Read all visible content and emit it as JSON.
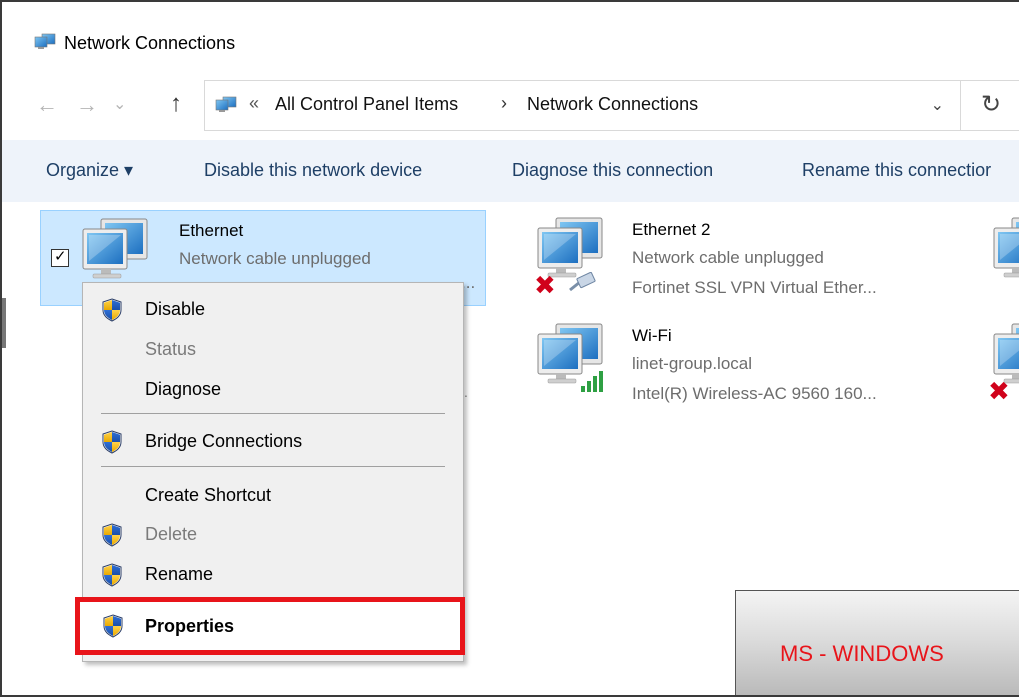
{
  "window": {
    "title": "Network Connections",
    "title_icon": "network-connections-icon"
  },
  "address": {
    "chevrons": "«",
    "crumb1": "All Control Panel Items",
    "separator": "›",
    "crumb2": "Network Connections"
  },
  "nav": {
    "back": "←",
    "forward": "→",
    "recent": "⌄",
    "up": "↑",
    "dropdown": "⌄",
    "refresh": "↻"
  },
  "commands": {
    "organize": "Organize ▾",
    "disable": "Disable this network device",
    "diagnose": "Diagnose this connection",
    "rename": "Rename this connectior"
  },
  "items": {
    "ethernet": {
      "name": "Ethernet",
      "status": "Network cable unplugged",
      "device_tail": "..."
    },
    "ethernet2": {
      "name": "Ethernet 2",
      "status": "Network cable unplugged",
      "device": "Fortinet SSL VPN Virtual Ether..."
    },
    "wifi": {
      "name": "Wi-Fi",
      "status": "linet-group.local",
      "device": "Intel(R) Wireless-AC 9560 160..."
    },
    "stray_dot": "."
  },
  "context_menu": {
    "disable": "Disable",
    "status": "Status",
    "diagnose": "Diagnose",
    "bridge": "Bridge Connections",
    "shortcut": "Create Shortcut",
    "delete": "Delete",
    "rename": "Rename",
    "properties": "Properties"
  },
  "watermark": {
    "text": "MS - WINDOWS"
  },
  "colors": {
    "selection_bg": "#cce8ff",
    "command_bar": "#eef3fa",
    "highlight_red": "#e8141a",
    "error_red": "#d0021b"
  }
}
